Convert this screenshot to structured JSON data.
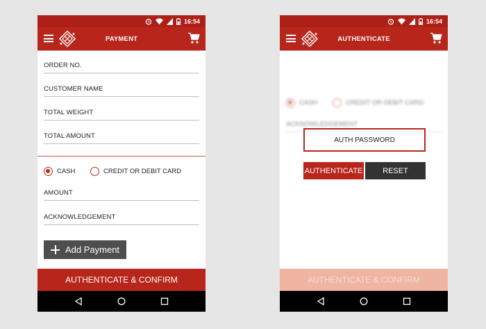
{
  "status_bar": {
    "time": "16:54"
  },
  "left": {
    "title": "PAYMENT",
    "fields": {
      "order_no": "ORDER NO.",
      "customer_name": "CUSTOMER NAME",
      "total_weight": "TOTAL WEIGHT",
      "total_amount": "TOTAL  AMOUNT",
      "amount": "AMOUNT",
      "acknowledgement": "ACKNOWLEDGEMENT"
    },
    "payment_options": {
      "cash": "CASH",
      "card": "CREDIT  OR DEBIT CARD",
      "selected": "CASH"
    },
    "add_payment_label": "Add Payment",
    "confirm_label": "AUTHENTICATE & CONFIRM"
  },
  "right": {
    "title": "AUTHENTICATE",
    "payment_options": {
      "cash": "CASH",
      "card": "CREDIT  OR DEBIT CARD"
    },
    "acknowledgement": "ACKNOWLEDGEMENT",
    "auth_password_placeholder": "AUTH PASSWORD",
    "authenticate_label": "AUTHENTICATE",
    "reset_label": "RESET",
    "confirm_label": "AUTHENTICATE & CONFIRM"
  },
  "colors": {
    "primary": "#b8251b",
    "dark_button": "#4e4e4e",
    "background": "#e6e6e6"
  },
  "icons": [
    "menu-icon",
    "app-logo-icon",
    "cart-icon",
    "alarm-icon",
    "wifi-icon",
    "signal-icon",
    "battery-icon",
    "back-icon",
    "home-icon",
    "recents-icon"
  ]
}
